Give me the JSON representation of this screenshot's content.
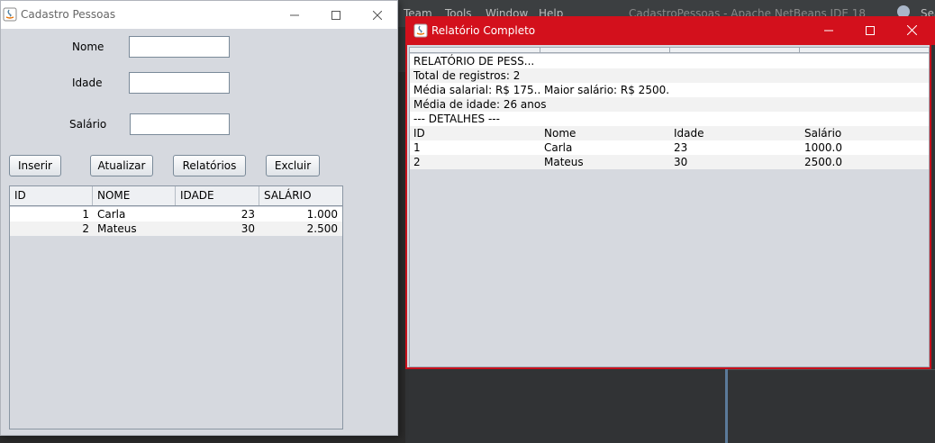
{
  "netbeans": {
    "menus": [
      "Team",
      "Tools",
      "Window",
      "Help"
    ],
    "title": "CadastroPessoas - Apache NetBeans IDE 18",
    "search_text": "Sea"
  },
  "cadastro": {
    "title": "Cadastro Pessoas",
    "labels": {
      "nome": "Nome",
      "idade": "Idade",
      "salario": "Salário"
    },
    "fields": {
      "nome": "",
      "idade": "",
      "salario": ""
    },
    "buttons": {
      "inserir": "Inserir",
      "atualizar": "Atualizar",
      "relatorios": "Relatórios",
      "excluir": "Excluir"
    },
    "table": {
      "columns": [
        "ID",
        "NOME",
        "IDADE",
        "SALÁRIO"
      ],
      "rows": [
        {
          "id": "1",
          "nome": "Carla",
          "idade": "23",
          "salario": "1.000"
        },
        {
          "id": "2",
          "nome": "Mateus",
          "idade": "30",
          "salario": "2.500"
        }
      ]
    }
  },
  "relatorio": {
    "title": "Relatório Completo",
    "lines": {
      "heading": "RELATÓRIO DE PESS...",
      "total": "Total de registros: 2",
      "media_salarial": "Média salarial: R$ 175...",
      "maior_salario": "Maior salário: R$ 2500...",
      "media_idade": "Média de idade: 26 anos",
      "detalhes": "--- DETALHES ---"
    },
    "detail_columns": [
      "ID",
      "Nome",
      "Idade",
      "Salário"
    ],
    "detail_rows": [
      {
        "id": "1",
        "nome": "Carla",
        "idade": "23",
        "salario": "1000.0"
      },
      {
        "id": "2",
        "nome": "Mateus",
        "idade": "30",
        "salario": "2500.0"
      }
    ]
  },
  "colors": {
    "accent_red": "#d3101c",
    "window_bg": "#d6d9df",
    "ide_bg": "#3c3f41"
  }
}
